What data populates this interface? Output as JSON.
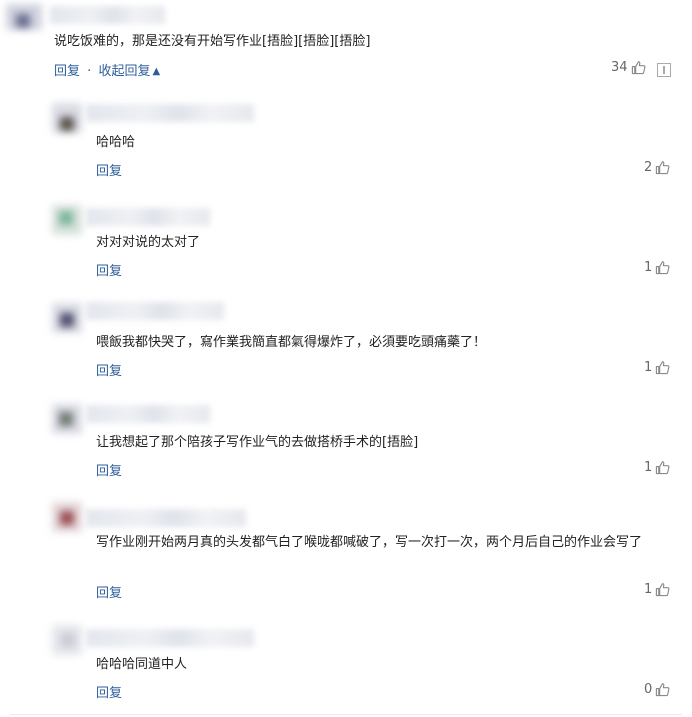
{
  "main_comment": {
    "text": "说吃饭难的，那是还没有开始写作业[捂脸][捂脸][捂脸]",
    "reply_label": "回复",
    "collapse_label": "收起回复",
    "separator": "·",
    "collapse_icon": "chevron-up-icon",
    "likes": "34",
    "report_icon": "report-icon"
  },
  "replies": [
    {
      "text": "哈哈哈",
      "reply_label": "回复",
      "likes": "2"
    },
    {
      "text": "对对对说的太对了",
      "reply_label": "回复",
      "likes": "1"
    },
    {
      "text": "喂飯我都快哭了，寫作業我簡直都氣得爆炸了，必須要吃頭痛藥了！",
      "reply_label": "回复",
      "likes": "1"
    },
    {
      "text": "让我想起了那个陪孩子写作业气的去做搭桥手术的[捂脸]",
      "reply_label": "回复",
      "likes": "1"
    },
    {
      "text": "写作业刚开始两月真的头发都气白了喉咙都喊破了，写一次打一次，两个月后自己的作业会写了",
      "reply_label": "回复",
      "likes": "1"
    },
    {
      "text": "哈哈哈同道中人",
      "reply_label": "回复",
      "likes": "0"
    }
  ],
  "colors": {
    "link": "#2f5e9c",
    "text": "#222222",
    "count": "#666666"
  },
  "icons": {
    "like": "thumbs-up-icon"
  }
}
